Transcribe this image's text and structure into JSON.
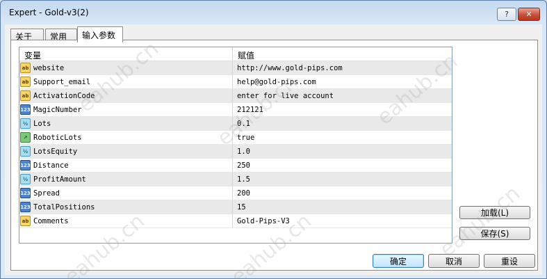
{
  "window": {
    "title": "Expert - Gold-v3(2)",
    "help_label": "?",
    "close_label": "✕"
  },
  "tabs": [
    {
      "label": "关于"
    },
    {
      "label": "常用"
    },
    {
      "label": "输入参数",
      "selected": true
    }
  ],
  "grid": {
    "headers": {
      "variable": "变量",
      "value": "赋值"
    },
    "rows": [
      {
        "icon": "ab-string-icon",
        "glyph": "ab",
        "name": "website",
        "value": "http://www.gold-pips.com"
      },
      {
        "icon": "ab-string-icon",
        "glyph": "ab",
        "name": "Support_email",
        "value": "help@gold-pips.com"
      },
      {
        "icon": "ab-string-icon",
        "glyph": "ab",
        "name": "ActivationCode",
        "value": "enter for live account"
      },
      {
        "icon": "integer-123-icon",
        "glyph": "123",
        "name": "MagicNumber",
        "value": "212121"
      },
      {
        "icon": "double-half-icon",
        "glyph": "½",
        "name": "Lots",
        "value": "0.1"
      },
      {
        "icon": "bool-toggle-icon",
        "glyph": "↗",
        "name": "RoboticLots",
        "value": "true"
      },
      {
        "icon": "double-half-icon",
        "glyph": "½",
        "name": "LotsEquity",
        "value": "1.0"
      },
      {
        "icon": "integer-123-icon",
        "glyph": "123",
        "name": "Distance",
        "value": "250"
      },
      {
        "icon": "double-half-icon",
        "glyph": "½",
        "name": "ProfitAmount",
        "value": "1.5"
      },
      {
        "icon": "integer-123-icon",
        "glyph": "123",
        "name": "Spread",
        "value": "200"
      },
      {
        "icon": "integer-123-icon",
        "glyph": "123",
        "name": "TotalPositions",
        "value": "15"
      },
      {
        "icon": "ab-string-icon",
        "glyph": "ab",
        "name": "Comments",
        "value": "Gold-Pips-V3"
      }
    ]
  },
  "side_buttons": {
    "load": "加载(L)",
    "save": "保存(S)"
  },
  "bottom_buttons": {
    "ok": "确定",
    "cancel": "取消",
    "reset": "重设"
  },
  "watermark": "eahub.cn",
  "colors": {
    "accent": "#3c7fb1",
    "close": "#c7503a"
  }
}
